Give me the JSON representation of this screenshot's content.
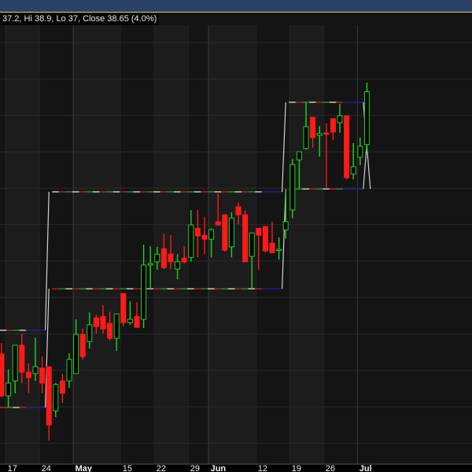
{
  "header": {
    "readout": "37.2, Hi 38.9, Lo 37, Close 38.65 (4.0%)"
  },
  "colors": {
    "up": "#22d022",
    "down": "#ff1a1a",
    "topbar": "#2c4166",
    "band_light": "#1c1c1c",
    "band_dark": "#141414",
    "grid": "#2a2a2a",
    "box_line": "#d0d0d0",
    "box_blue": "#2020a0"
  },
  "chart_data": {
    "type": "candlestick",
    "title": "",
    "price_grid": [
      29,
      30,
      31,
      32,
      33,
      34,
      35,
      36,
      37,
      38,
      39,
      40
    ],
    "x_ticks": [
      {
        "label": "17",
        "index": 1,
        "month": false
      },
      {
        "label": "24",
        "index": 6,
        "month": false
      },
      {
        "label": "May",
        "index": 11,
        "month": true
      },
      {
        "label": "15",
        "index": 18,
        "month": false
      },
      {
        "label": "22",
        "index": 23,
        "month": false
      },
      {
        "label": "29",
        "index": 28,
        "month": false
      },
      {
        "label": "Jun",
        "index": 31,
        "month": true
      },
      {
        "label": "12",
        "index": 38,
        "month": false
      },
      {
        "label": "19",
        "index": 43,
        "month": false
      },
      {
        "label": "26",
        "index": 48,
        "month": false
      },
      {
        "label": "Jul",
        "index": 53,
        "month": true
      }
    ],
    "candles": [
      [
        31.45,
        31.75,
        30.26,
        30.3
      ],
      [
        30.3,
        31.02,
        29.98,
        30.65
      ],
      [
        30.71,
        31.69,
        30.37,
        31.69
      ],
      [
        31.69,
        32.01,
        30.65,
        30.95
      ],
      [
        30.95,
        31.19,
        30.37,
        30.8
      ],
      [
        30.91,
        31.9,
        30.71,
        31.1
      ],
      [
        31.06,
        31.38,
        30.37,
        30.65
      ],
      [
        31.1,
        31.1,
        29.07,
        29.5
      ],
      [
        29.89,
        30.65,
        29.72,
        30.61
      ],
      [
        30.71,
        30.91,
        30.11,
        30.37
      ],
      [
        30.71,
        31.47,
        30.52,
        31.3
      ],
      [
        30.91,
        32.4,
        30.91,
        31.99
      ],
      [
        31.99,
        32.14,
        31.3,
        31.38
      ],
      [
        31.79,
        32.59,
        31.6,
        32.25
      ],
      [
        32.44,
        32.53,
        32.01,
        32.2
      ],
      [
        32.48,
        32.79,
        32.01,
        32.14
      ],
      [
        32.29,
        32.61,
        31.82,
        31.88
      ],
      [
        31.88,
        32.55,
        31.53,
        32.55
      ],
      [
        33.11,
        33.11,
        32.2,
        32.31
      ],
      [
        32.31,
        32.9,
        32.25,
        32.4
      ],
      [
        32.48,
        32.87,
        32.16,
        32.18
      ],
      [
        32.4,
        34.45,
        32.16,
        33.89
      ],
      [
        33.89,
        34.41,
        33.24,
        33.93
      ],
      [
        33.98,
        34.39,
        33.76,
        34.19
      ],
      [
        34.34,
        34.75,
        33.78,
        33.82
      ],
      [
        34.19,
        34.71,
        33.78,
        33.98
      ],
      [
        33.78,
        34.19,
        33.5,
        33.98
      ],
      [
        34.08,
        34.41,
        33.93,
        33.98
      ],
      [
        34.1,
        35.4,
        33.98,
        34.99
      ],
      [
        34.9,
        35.4,
        34.1,
        34.69
      ],
      [
        34.71,
        35.21,
        34.19,
        34.6
      ],
      [
        34.6,
        34.9,
        34.1,
        34.86
      ],
      [
        35.08,
        35.85,
        34.97,
        34.99
      ],
      [
        35.27,
        35.29,
        34.26,
        34.3
      ],
      [
        34.39,
        35.34,
        34.1,
        35.18
      ],
      [
        35.49,
        35.6,
        35.01,
        35.27
      ],
      [
        35.27,
        35.4,
        33.98,
        33.98
      ],
      [
        34.13,
        34.77,
        33.24,
        34.77
      ],
      [
        34.9,
        34.9,
        33.76,
        34.71
      ],
      [
        34.95,
        34.95,
        34.23,
        34.28
      ],
      [
        34.49,
        35.08,
        34.21,
        34.23
      ],
      [
        34.3,
        34.65,
        34.04,
        34.32
      ],
      [
        34.86,
        35.98,
        34.62,
        35.08
      ],
      [
        35.4,
        36.8,
        35.18,
        36.65
      ],
      [
        36.78,
        37.0,
        35.98,
        37.0
      ],
      [
        37.09,
        38.36,
        37.06,
        37.69
      ],
      [
        37.95,
        37.95,
        37.11,
        37.39
      ],
      [
        37.45,
        37.71,
        36.87,
        37.5
      ],
      [
        37.52,
        37.78,
        35.98,
        37.48
      ],
      [
        37.91,
        37.91,
        37.32,
        37.54
      ],
      [
        37.8,
        38.32,
        37.52,
        37.99
      ],
      [
        37.99,
        37.99,
        36.24,
        36.29
      ],
      [
        36.39,
        37.24,
        36.24,
        36.59
      ],
      [
        36.85,
        37.39,
        36.63,
        37.15
      ],
      [
        37.2,
        38.9,
        37.0,
        38.65
      ]
    ],
    "boxes": [
      {
        "start": -1,
        "end": 6,
        "top": 32.1,
        "bottom": 29.98
      },
      {
        "start": 7,
        "end": 41,
        "top": 35.9,
        "bottom": 33.24
      },
      {
        "start": 42,
        "end": 53,
        "top": 38.36,
        "bottom": 35.98
      }
    ]
  }
}
